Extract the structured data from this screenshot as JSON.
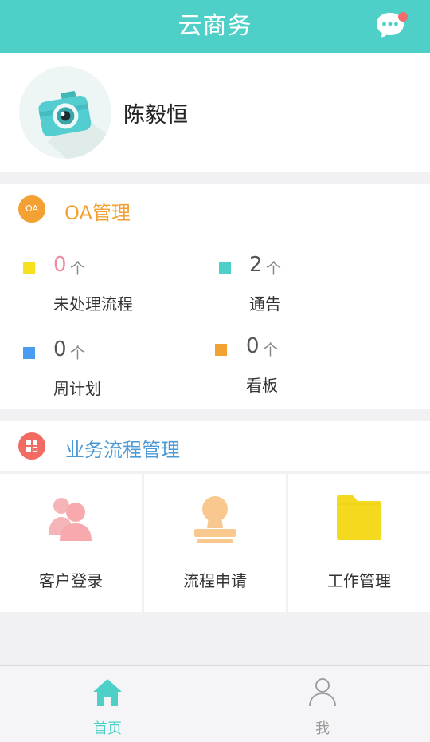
{
  "header": {
    "title": "云商务",
    "chat_icon": "chat-bubble-icon",
    "badge_color": "#f06d6d"
  },
  "profile": {
    "name": "陈毅恒",
    "avatar_icon": "camera-icon"
  },
  "oa": {
    "icon_text": "OA",
    "title": "OA管理",
    "unit": "个",
    "stats": [
      {
        "value": "0",
        "label": "未处理流程",
        "color": "#f7e11e",
        "value_color": "#f08aa0"
      },
      {
        "value": "2",
        "label": "通告",
        "color": "#4ecfc8",
        "value_color": "#555555"
      },
      {
        "value": "0",
        "label": "周计划",
        "color": "#4a9cf0",
        "value_color": "#555555"
      },
      {
        "value": "0",
        "label": "看板",
        "color": "#f3a133",
        "value_color": "#555555"
      }
    ]
  },
  "business": {
    "title": "业务流程管理",
    "icon": "grid-icon",
    "tiles": [
      {
        "label": "客户登录",
        "icon": "users-icon"
      },
      {
        "label": "流程申请",
        "icon": "stamp-icon"
      },
      {
        "label": "工作管理",
        "icon": "folder-icon"
      }
    ]
  },
  "tabbar": {
    "tabs": [
      {
        "label": "首页",
        "icon": "home-icon",
        "active": true
      },
      {
        "label": "我",
        "icon": "person-icon",
        "active": false
      }
    ],
    "active_color": "#4ecfc8",
    "inactive_color": "#999999"
  }
}
